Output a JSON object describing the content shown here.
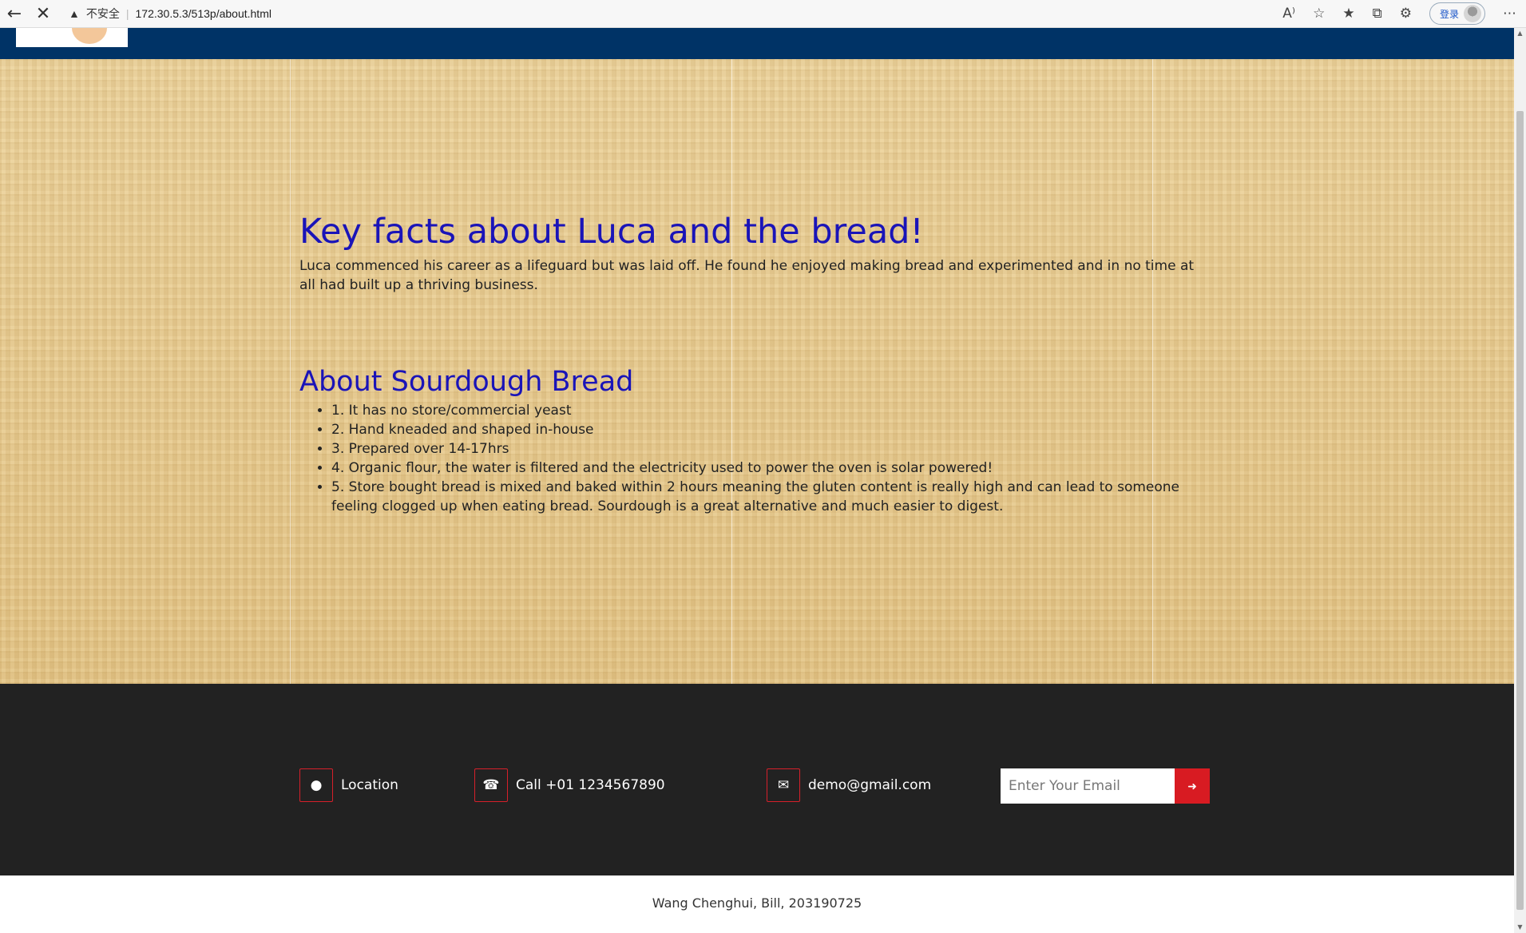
{
  "browser": {
    "back_icon": "back-arrow-icon",
    "stop_icon": "close-icon",
    "security_label": "不安全",
    "url": "172.30.5.3/513p/about.html",
    "login_label": "登录"
  },
  "content": {
    "heading_key": "Key facts about Luca and the bread!",
    "paragraph_key": "Luca commenced his career as a lifeguard but was laid off. He found he enjoyed making bread and experimented and in no time at all had built up a thriving business.",
    "heading_about": "About Sourdough Bread",
    "facts": [
      "1. It has no store/commercial yeast",
      "2. Hand kneaded and shaped in-house",
      "3. Prepared over 14-17hrs",
      "4. Organic flour, the water is filtered and the electricity used to power the oven is solar powered!",
      "5. Store bought bread is mixed and baked within 2 hours meaning the gluten content is really high and can lead to someone feeling clogged up when eating bread. Sourdough is a great alternative and much easier to digest."
    ]
  },
  "footer": {
    "location_label": "Location",
    "call_label": "Call +01 1234567890",
    "email_label": "demo@gmail.com",
    "email_placeholder": "Enter Your Email",
    "accent_color": "#d81b22"
  },
  "credit": "Wang Chenghui, Bill, 203190725"
}
